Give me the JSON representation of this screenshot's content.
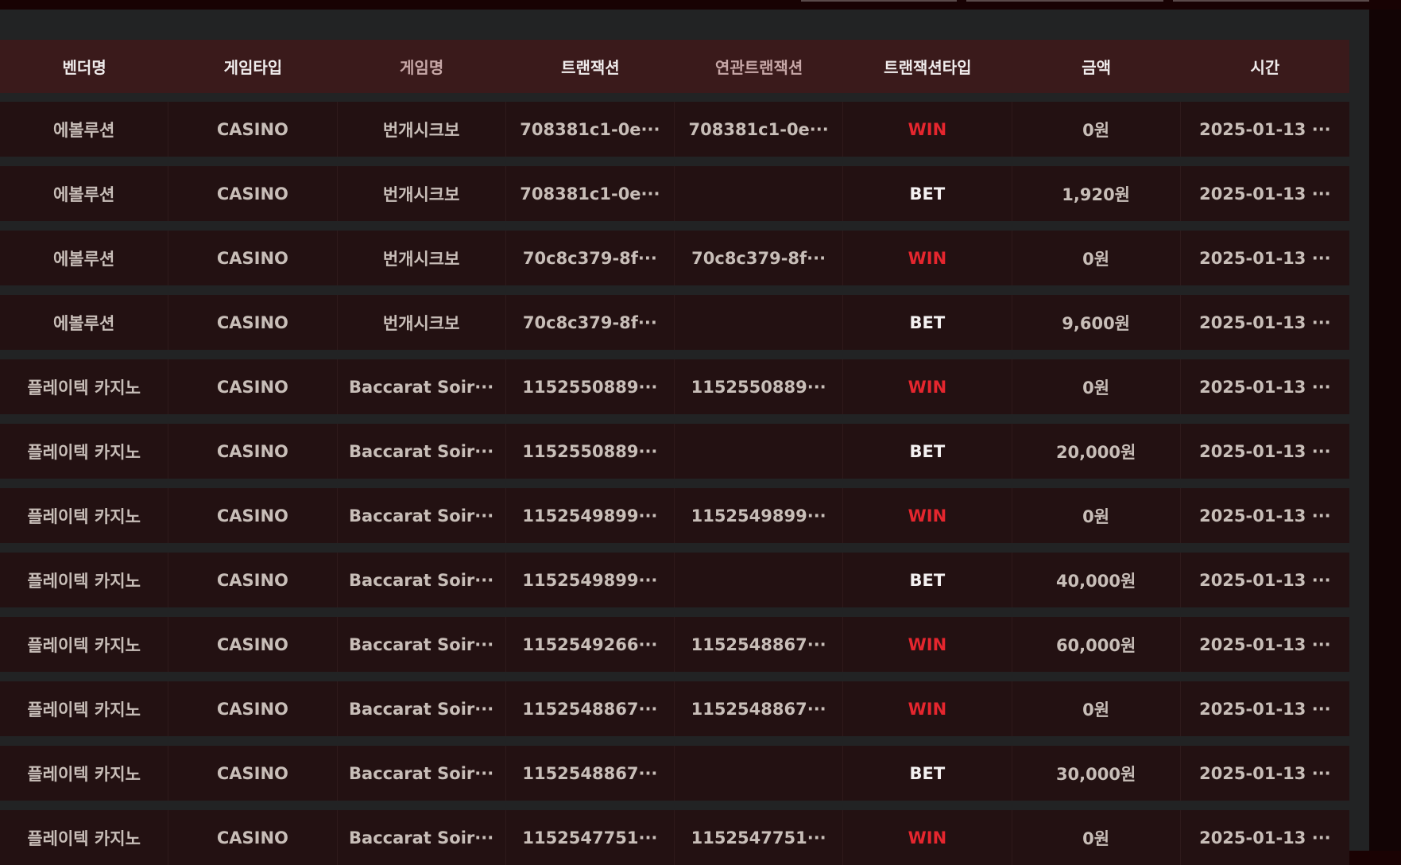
{
  "columns": {
    "vendor": "벤더명",
    "game_type": "게임타입",
    "game_name": "게임명",
    "transaction": "트랜잭션",
    "related_transaction": "연관트랜잭션",
    "transaction_type": "트랜잭션타입",
    "amount": "금액",
    "time": "시간"
  },
  "rows": [
    {
      "vendor": "에볼루션",
      "game_type": "CASINO",
      "game_name": "번개시크보",
      "transaction": "708381c1-0e···",
      "related_transaction": "708381c1-0e···",
      "transaction_type": "WIN",
      "amount": "0원",
      "time": "2025-01-13 ···"
    },
    {
      "vendor": "에볼루션",
      "game_type": "CASINO",
      "game_name": "번개시크보",
      "transaction": "708381c1-0e···",
      "related_transaction": "",
      "transaction_type": "BET",
      "amount": "1,920원",
      "time": "2025-01-13 ···"
    },
    {
      "vendor": "에볼루션",
      "game_type": "CASINO",
      "game_name": "번개시크보",
      "transaction": "70c8c379-8f···",
      "related_transaction": "70c8c379-8f···",
      "transaction_type": "WIN",
      "amount": "0원",
      "time": "2025-01-13 ···"
    },
    {
      "vendor": "에볼루션",
      "game_type": "CASINO",
      "game_name": "번개시크보",
      "transaction": "70c8c379-8f···",
      "related_transaction": "",
      "transaction_type": "BET",
      "amount": "9,600원",
      "time": "2025-01-13 ···"
    },
    {
      "vendor": "플레이텍 카지노",
      "game_type": "CASINO",
      "game_name": "Baccarat Soir···",
      "transaction": "1152550889···",
      "related_transaction": "1152550889···",
      "transaction_type": "WIN",
      "amount": "0원",
      "time": "2025-01-13 ···"
    },
    {
      "vendor": "플레이텍 카지노",
      "game_type": "CASINO",
      "game_name": "Baccarat Soir···",
      "transaction": "1152550889···",
      "related_transaction": "",
      "transaction_type": "BET",
      "amount": "20,000원",
      "time": "2025-01-13 ···"
    },
    {
      "vendor": "플레이텍 카지노",
      "game_type": "CASINO",
      "game_name": "Baccarat Soir···",
      "transaction": "1152549899···",
      "related_transaction": "1152549899···",
      "transaction_type": "WIN",
      "amount": "0원",
      "time": "2025-01-13 ···"
    },
    {
      "vendor": "플레이텍 카지노",
      "game_type": "CASINO",
      "game_name": "Baccarat Soir···",
      "transaction": "1152549899···",
      "related_transaction": "",
      "transaction_type": "BET",
      "amount": "40,000원",
      "time": "2025-01-13 ···"
    },
    {
      "vendor": "플레이텍 카지노",
      "game_type": "CASINO",
      "game_name": "Baccarat Soir···",
      "transaction": "1152549266···",
      "related_transaction": "1152548867···",
      "transaction_type": "WIN",
      "amount": "60,000원",
      "time": "2025-01-13 ···"
    },
    {
      "vendor": "플레이텍 카지노",
      "game_type": "CASINO",
      "game_name": "Baccarat Soir···",
      "transaction": "1152548867···",
      "related_transaction": "1152548867···",
      "transaction_type": "WIN",
      "amount": "0원",
      "time": "2025-01-13 ···"
    },
    {
      "vendor": "플레이텍 카지노",
      "game_type": "CASINO",
      "game_name": "Baccarat Soir···",
      "transaction": "1152548867···",
      "related_transaction": "",
      "transaction_type": "BET",
      "amount": "30,000원",
      "time": "2025-01-13 ···"
    },
    {
      "vendor": "플레이텍 카지노",
      "game_type": "CASINO",
      "game_name": "Baccarat Soir···",
      "transaction": "1152547751···",
      "related_transaction": "1152547751···",
      "transaction_type": "WIN",
      "amount": "0원",
      "time": "2025-01-13 ···"
    }
  ],
  "colors": {
    "win": "#e5262e",
    "bet": "#f4f1f1",
    "header_bg": "#3a1a1b",
    "row_bg": "#231112"
  }
}
